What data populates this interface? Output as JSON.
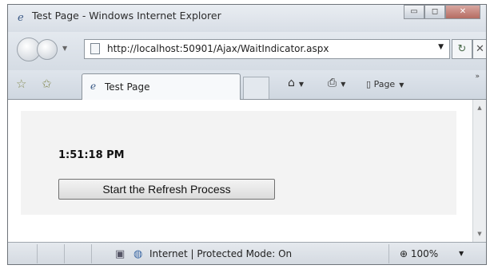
{
  "window": {
    "title": "Test Page - Windows Internet Explorer",
    "minimize_glyph": "▭",
    "maximize_glyph": "◻",
    "close_glyph": "✕"
  },
  "address": {
    "url": "http://localhost:50901/Ajax/WaitIndicator.aspx",
    "dropdown_glyph": "▼",
    "refresh_glyph": "↻",
    "stop_glyph": "✕"
  },
  "tabs": {
    "active_label": "Test Page"
  },
  "commands": {
    "home_glyph": "⌂",
    "print_glyph": "⎙",
    "page_label": "Page",
    "dropdown_glyph": "▼",
    "more_glyph": "»"
  },
  "page": {
    "time": "1:51:18 PM",
    "button_label": "Start the Refresh Process"
  },
  "status": {
    "zone_text": "Internet | Protected Mode: On",
    "zoom": "100%",
    "zoom_icon_glyph": "⊕",
    "dropdown_glyph": "▼"
  },
  "icons": {
    "browser": "ie-logo-icon",
    "favorites": "favorites-star-icon",
    "add_favorites": "add-favorites-icon",
    "home": "home-icon",
    "print": "print-icon",
    "page": "page-icon",
    "globe": "globe-icon",
    "zoom": "zoom-icon"
  },
  "colors": {
    "chrome": "#dfe4ea",
    "close_button": "#b56c62",
    "content_panel": "#f3f3f3"
  }
}
